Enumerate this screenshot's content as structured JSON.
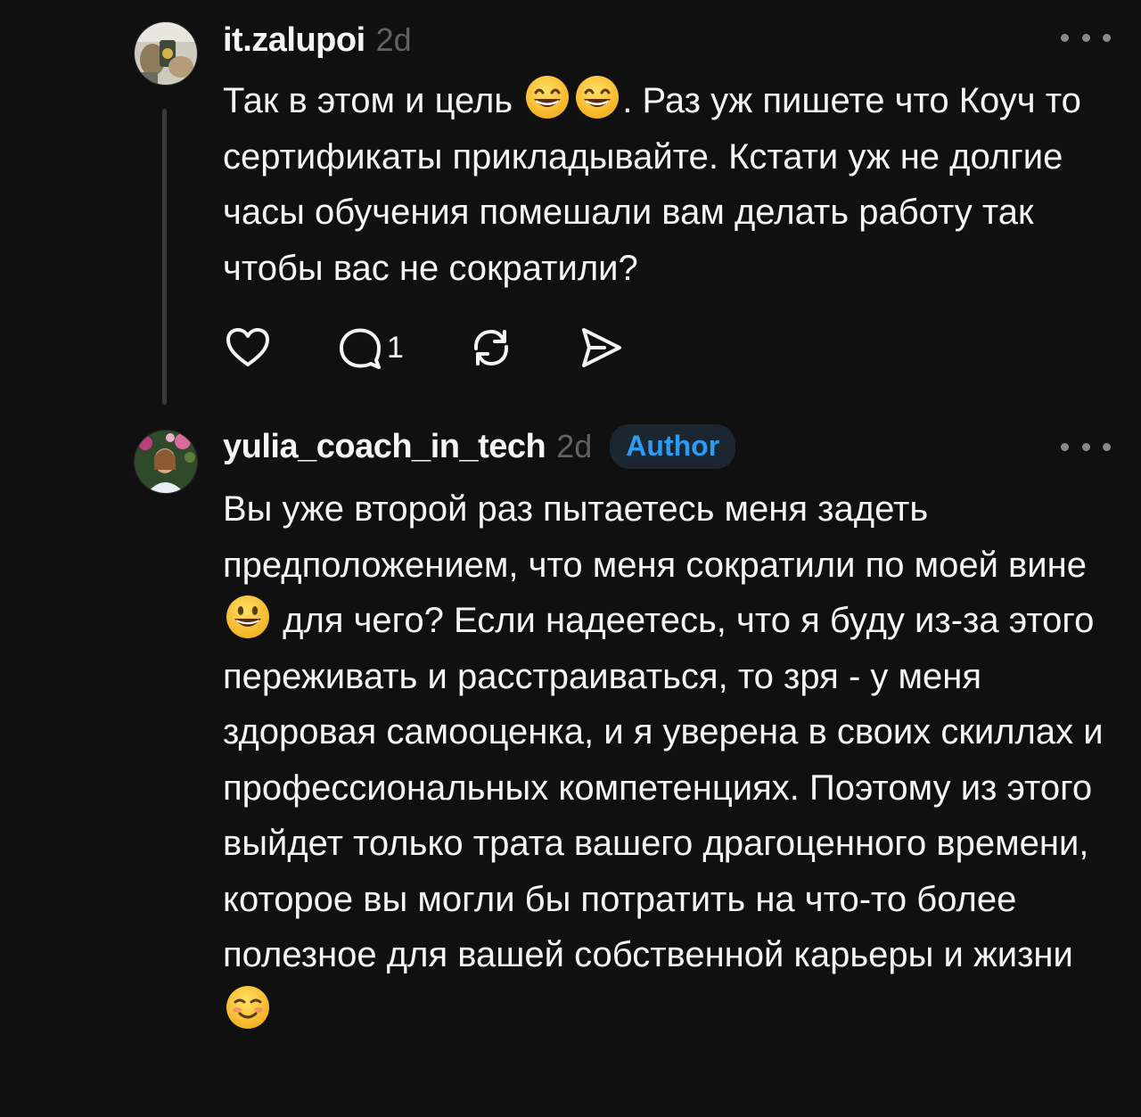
{
  "comments": [
    {
      "username": "it.zalupoi",
      "time": "2d",
      "text_parts": [
        "Так в этом и цель ",
        ". Раз уж пишете что Коуч то сертификаты прикладывайте. Кстати уж не долгие часы обучения помешали вам делать работу так чтобы вас не сократили?"
      ],
      "emojis": [
        "grinning-face-with-smiling-eyes",
        "grinning-face-with-smiling-eyes"
      ],
      "actions": {
        "like_icon": "heart-icon",
        "reply_icon": "comment-icon",
        "reply_count": "1",
        "repost_icon": "repost-icon",
        "share_icon": "send-icon"
      }
    },
    {
      "username": "yulia_coach_in_tech",
      "time": "2d",
      "badge": "Author",
      "text_parts": [
        "Вы уже второй раз пытаетесь меня задеть предположением, что меня сократили по моей вине ",
        " для чего? Если надеетесь, что я буду из-за этого переживать и расстраиваться, то зря - у меня здоровая самооценка, и я уверена в своих скиллах и профессиональных компетенциях. Поэтому из этого выйдет только трата вашего драгоценного времени, которое вы могли бы потратить на что-то более полезное для вашей собственной карьеры и жизни "
      ],
      "emojis": [
        "smiling-face-with-open-mouth",
        "smiling-face"
      ]
    }
  ],
  "colors": {
    "background": "#101010",
    "text": "#f3f5f7",
    "muted": "#616161",
    "badge_text": "#2b9bf4",
    "badge_bg": "#1b2631",
    "emoji_yellow": "#ffcc33"
  }
}
